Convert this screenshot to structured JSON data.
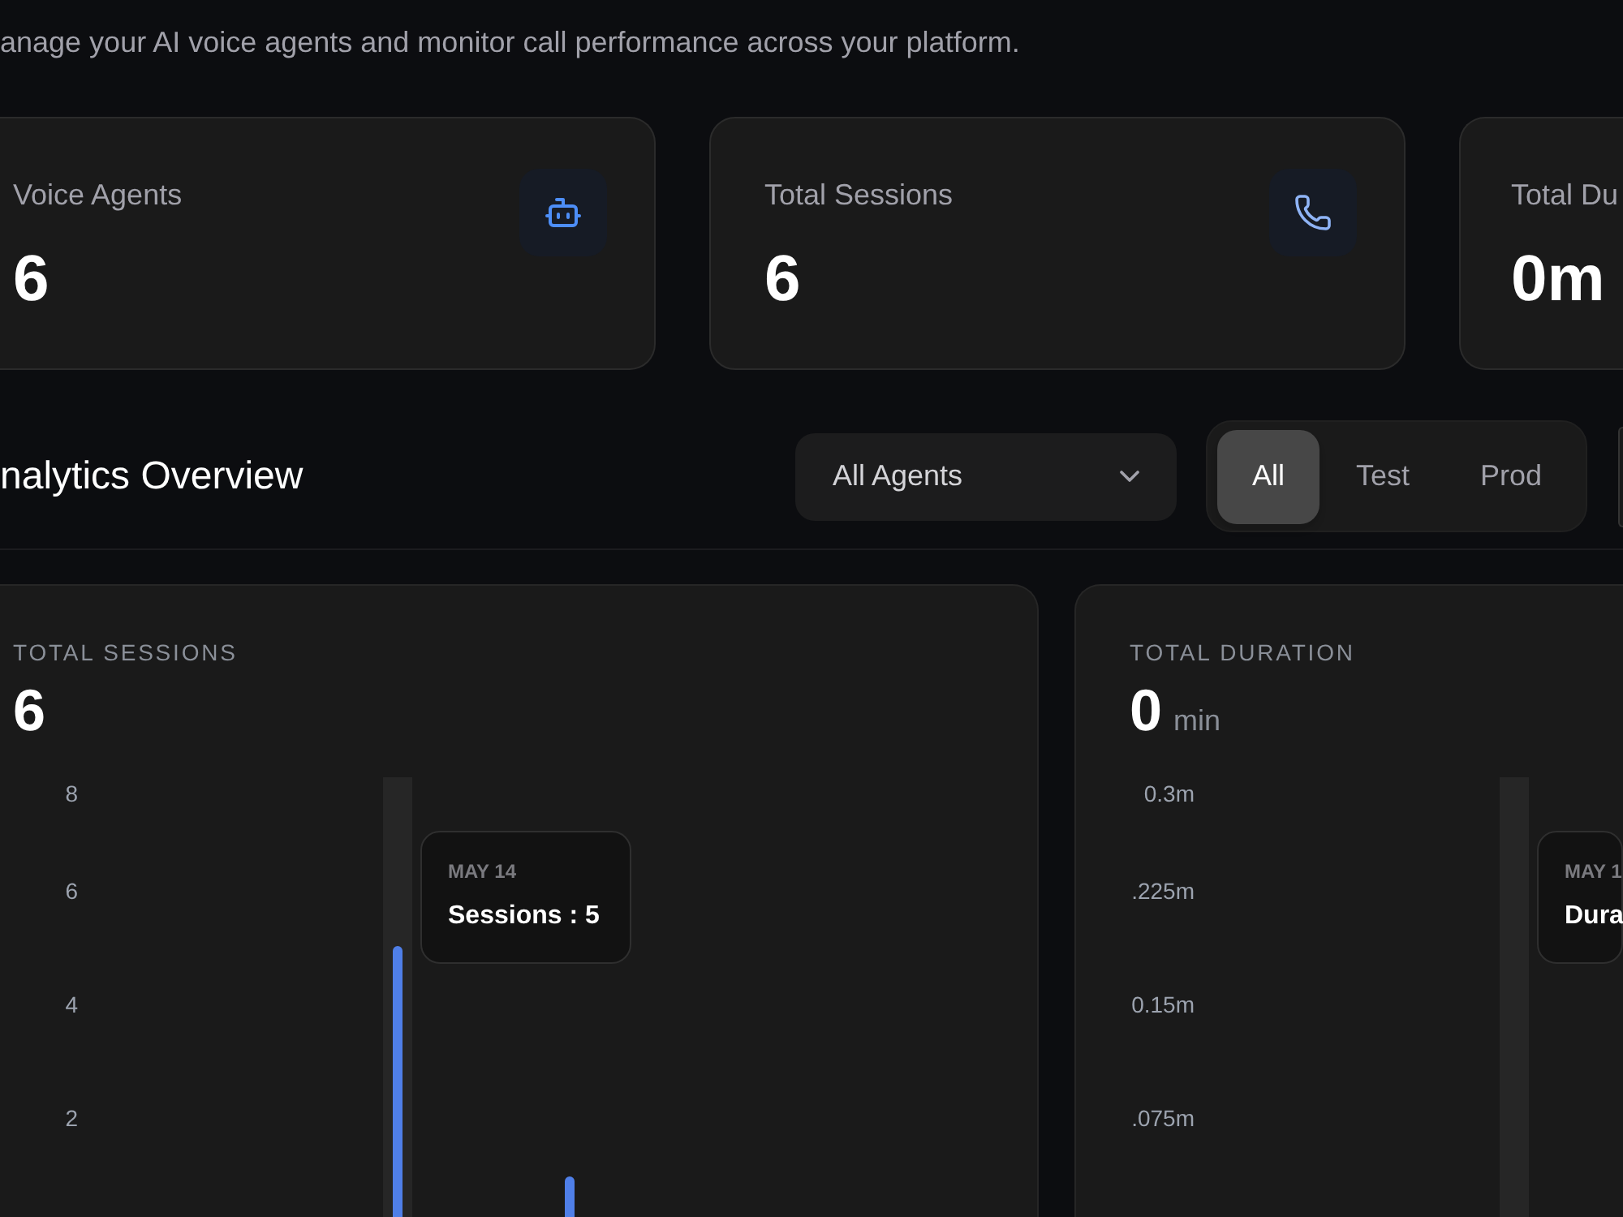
{
  "subtitle": "anage your AI voice agents and monitor call performance across your platform.",
  "stats": [
    {
      "label": "Voice Agents",
      "value": "6",
      "kind": "agents"
    },
    {
      "label": "Total Sessions",
      "value": "6",
      "kind": "sessions"
    },
    {
      "label": "Total Du",
      "value": "0m"
    }
  ],
  "section": {
    "title": "nalytics Overview",
    "agent_filter": {
      "value": "All Agents"
    },
    "environment_tabs": [
      {
        "label": "All",
        "selected": true
      },
      {
        "label": "Test",
        "selected": false
      },
      {
        "label": "Prod",
        "selected": false
      }
    ]
  },
  "charts": [
    {
      "title": "TOTAL SESSIONS",
      "value": "6",
      "y_axis_labels": [
        "8",
        "6",
        "4",
        "2"
      ],
      "tooltip": {
        "date": "MAY 14",
        "text": "Sessions : 5"
      }
    },
    {
      "title": "TOTAL DURATION",
      "value": "0",
      "unit": "min",
      "y_axis_labels": [
        "0.3m",
        ".225m",
        "0.15m",
        ".075m"
      ],
      "tooltip": {
        "date": "MAY 1",
        "text": "Dura"
      }
    }
  ]
}
